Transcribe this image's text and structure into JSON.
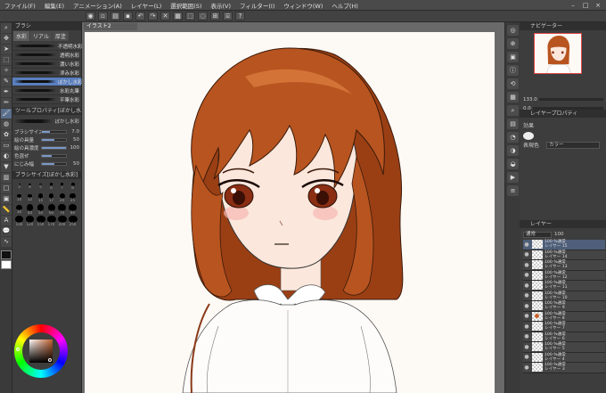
{
  "menu": [
    "ファイル(F)",
    "編集(E)",
    "アニメーション(A)",
    "レイヤー(L)",
    "選択範囲(S)",
    "表示(V)",
    "フィルター(I)",
    "ウィンドウ(W)",
    "ヘルプ(H)"
  ],
  "doc_tab": "イラスト2",
  "left_panel": {
    "title": "ブラシ",
    "tabs": [
      "水彩",
      "リアル",
      "厚塗"
    ],
    "brushes": [
      {
        "name": "不透明水彩"
      },
      {
        "name": "透明水彩"
      },
      {
        "name": "濃い水彩"
      },
      {
        "name": "滲み水彩"
      },
      {
        "name": "ぼかし水彩",
        "selected": true
      },
      {
        "name": "水彩丸筆"
      },
      {
        "name": "平筆水彩"
      }
    ],
    "tool_property_title": "ツールプロパティ[ぼかし水彩]",
    "tool_property_brush": "ぼかし水彩",
    "properties": [
      {
        "label": "ブラシサイズ",
        "value": "7.0",
        "fill": 0.35
      },
      {
        "label": "絵の具量",
        "value": "50",
        "fill": 0.5
      },
      {
        "label": "絵の具濃度",
        "value": "100",
        "fill": 1.0
      },
      {
        "label": "色混ぜ",
        "value": "",
        "fill": 0.4
      },
      {
        "label": "にじみ幅",
        "value": "50",
        "fill": 0.5
      }
    ],
    "brush_size_title": "ブラシサイズ[ぼかし水彩]",
    "brush_sizes": [
      "3",
      "4",
      "5",
      "6",
      "7",
      "8",
      "10",
      "12",
      "15",
      "17",
      "20",
      "25",
      "30",
      "40",
      "50",
      "60",
      "70",
      "80",
      "100",
      "120",
      "150",
      "170",
      "200",
      "250"
    ]
  },
  "navigator": {
    "title": "ナビゲーター",
    "zoom": "133.0",
    "rotation": "0.0"
  },
  "layer_property": {
    "title": "レイヤープロパティ",
    "effect_label": "効果",
    "expression_label": "表現色",
    "expression_value": "カラー"
  },
  "layers": {
    "title": "レイヤー",
    "blend": "通常",
    "opacity": "100",
    "items": [
      {
        "opacity": "100 %通常",
        "name": "レイヤー 15",
        "selected": true
      },
      {
        "opacity": "100 %通常",
        "name": "レイヤー 14"
      },
      {
        "opacity": "100 %通常",
        "name": "レイヤー 13"
      },
      {
        "opacity": "100 %通常",
        "name": "レイヤー 12"
      },
      {
        "opacity": "100 %通常",
        "name": "レイヤー 11"
      },
      {
        "opacity": "100 %通常",
        "name": "レイヤー 10"
      },
      {
        "opacity": "100 %通常",
        "name": "レイヤー 9"
      },
      {
        "opacity": "100 %通常",
        "name": "レイヤー 8",
        "thumb": true
      },
      {
        "opacity": "100 %通常",
        "name": "レイヤー 7"
      },
      {
        "opacity": "100 %通常",
        "name": "レイヤー 6"
      },
      {
        "opacity": "100 %通常",
        "name": "レイヤー 5"
      },
      {
        "opacity": "100 %通常",
        "name": "レイヤー 4"
      },
      {
        "opacity": "100 %通常",
        "name": "レイヤー 3"
      }
    ]
  },
  "colors": {
    "hair": "#b8541f",
    "hair_dark": "#7a2e0c",
    "skin": "#fbe7dc",
    "eye": "#8a2e14",
    "accent": "#5a7fbf"
  }
}
